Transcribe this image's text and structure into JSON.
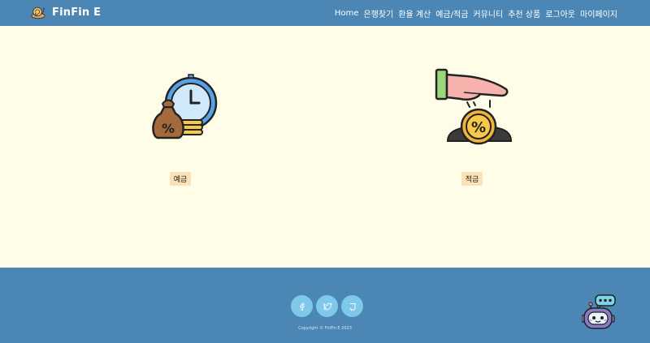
{
  "header": {
    "brand": "FinFin E",
    "menu": [
      "Home",
      "은행찾기",
      "환율 계산",
      "예금/적금",
      "커뮤니티",
      "추천 상품",
      "로그아웃",
      "마이페이지"
    ]
  },
  "products": {
    "deposit_label": "예금",
    "savings_label": "적금"
  },
  "footer": {
    "social_icons": [
      "facebook-icon",
      "twitter-icon",
      "github-icon"
    ],
    "copyright": "Copyright © FinFin E 2023"
  },
  "colors": {
    "nav": "#4b86b4",
    "background": "#fffde8",
    "label_badge": "#fbe1b6",
    "social_button": "#7ec8ea"
  }
}
